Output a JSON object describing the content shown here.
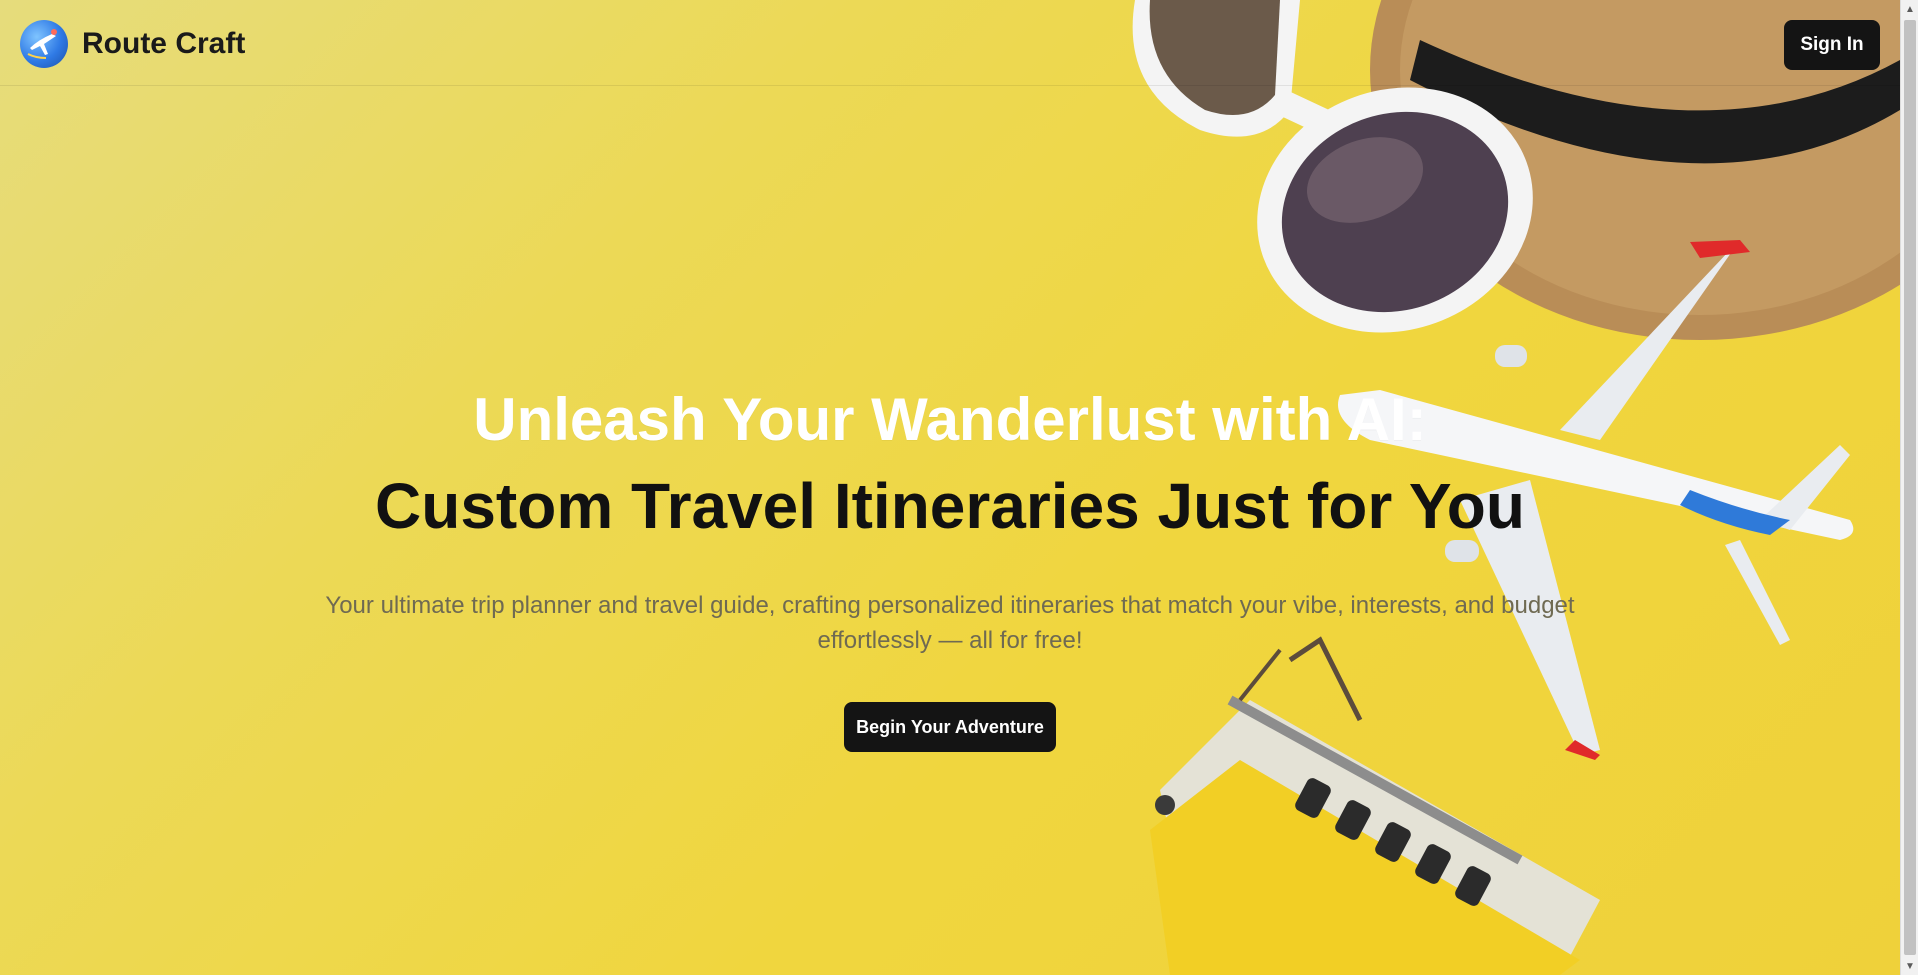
{
  "header": {
    "brand_name": "Route Craft",
    "logo_icon": "globe-plane-icon",
    "signin_label": "Sign In"
  },
  "hero": {
    "title_line1": "Unleash Your Wanderlust with AI:",
    "title_line2": "Custom Travel Itineraries Just for You",
    "subtitle": "Your ultimate trip planner and travel guide, crafting personalized itineraries that match your vibe, interests, and budget effortlessly — all for free!",
    "cta_label": "Begin Your Adventure"
  },
  "colors": {
    "background": "#efd34a",
    "button_dark": "#141414",
    "title_white": "#ffffff",
    "title_dark": "#111111",
    "subtitle_text": "#6f6a52"
  },
  "scrollbar": {
    "up_icon": "scroll-up-arrow-icon",
    "down_icon": "scroll-down-arrow-icon"
  }
}
